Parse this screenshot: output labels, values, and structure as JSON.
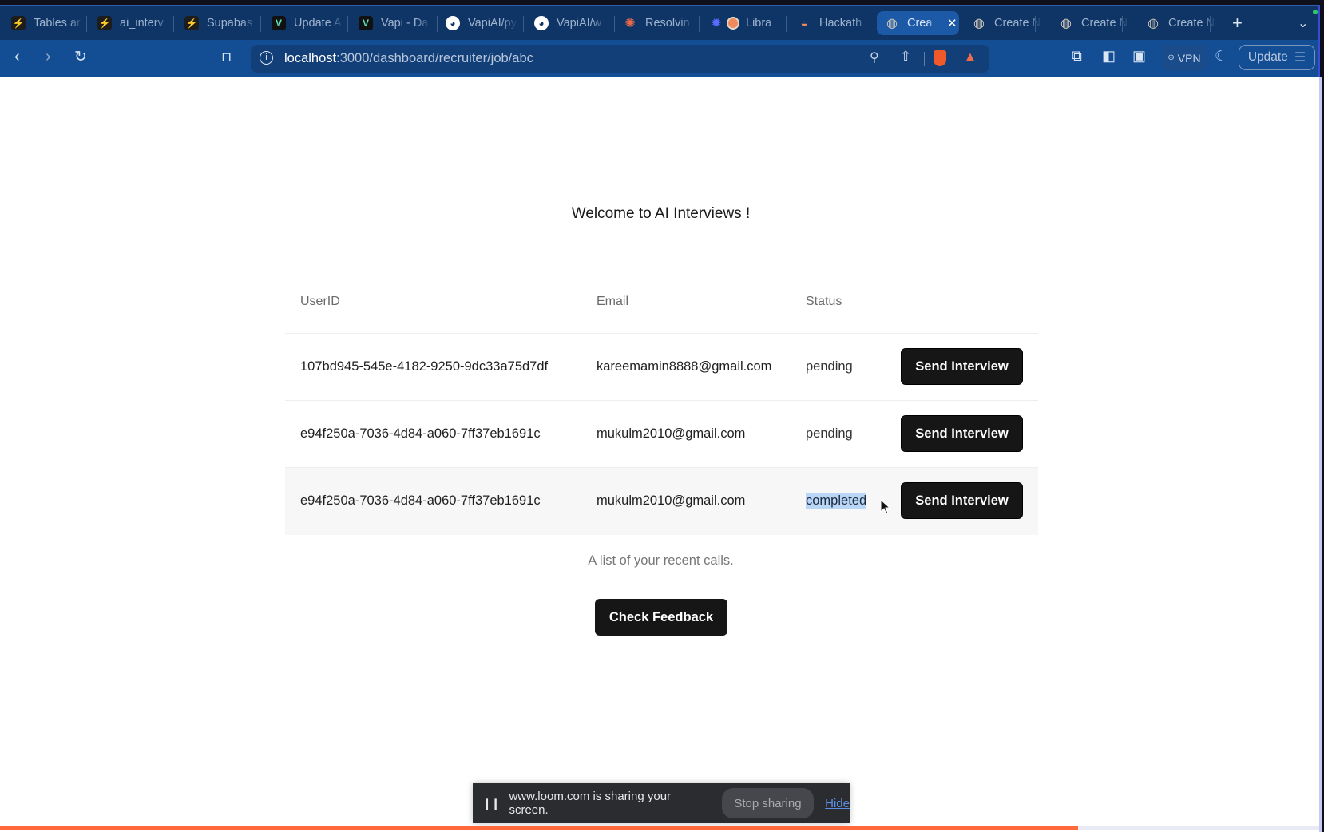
{
  "browser": {
    "tabs": [
      {
        "label": "Tables ar",
        "icon": "supabase-icon",
        "active": false
      },
      {
        "label": "ai_interv",
        "icon": "supabase-icon",
        "active": false
      },
      {
        "label": "Supabas",
        "icon": "supabase-icon",
        "active": false
      },
      {
        "label": "Update A",
        "icon": "vapi-icon",
        "active": false
      },
      {
        "label": "Vapi - Da",
        "icon": "vapi-icon",
        "active": false
      },
      {
        "label": "VapiAI/py",
        "icon": "github-icon",
        "active": false
      },
      {
        "label": "VapiAI/w",
        "icon": "github-icon",
        "active": false
      },
      {
        "label": "Resolvin",
        "icon": "bug-icon",
        "active": false
      },
      {
        "label": "Libra",
        "icon": "gear-icon",
        "active": false
      },
      {
        "label": "Hackath",
        "icon": "hackathon-icon",
        "active": false
      },
      {
        "label": "Crea",
        "icon": "globe-icon",
        "active": true
      },
      {
        "label": "Create N",
        "icon": "globe-icon",
        "active": false
      },
      {
        "label": "Create N",
        "icon": "globe-icon",
        "active": false
      },
      {
        "label": "Create N",
        "icon": "globe-icon",
        "active": false
      }
    ],
    "new_tab_label": "+",
    "url_host": "localhost",
    "url_path": ":3000/dashboard/recruiter/job/abc",
    "vpn_label": "VPN",
    "update_label": "Update"
  },
  "page": {
    "title": "Welcome to AI Interviews !",
    "table": {
      "headers": [
        "UserID",
        "Email",
        "Status"
      ],
      "rows": [
        {
          "user_id": "107bd945-545e-4182-9250-9dc33a75d7df",
          "email": "kareemamin8888@gmail.com",
          "status": "pending",
          "action": "Send Interview"
        },
        {
          "user_id": "e94f250a-7036-4d84-a060-7ff37eb1691c",
          "email": "mukulm2010@gmail.com",
          "status": "pending",
          "action": "Send Interview"
        },
        {
          "user_id": "e94f250a-7036-4d84-a060-7ff37eb1691c",
          "email": "mukulm2010@gmail.com",
          "status": "completed",
          "action": "Send Interview"
        }
      ],
      "caption": "A list of your recent calls."
    },
    "feedback_button": "Check Feedback"
  },
  "screen_share_bar": {
    "message": "www.loom.com is sharing your screen.",
    "stop_label": "Stop sharing",
    "hide_label": "Hide"
  },
  "recording_progress_percent": 81.7,
  "colors": {
    "tabbar": "#0e3566",
    "navbar": "#134e94",
    "button": "#161616",
    "progress": "#ff6a3d",
    "selection": "#b9d6f7"
  }
}
